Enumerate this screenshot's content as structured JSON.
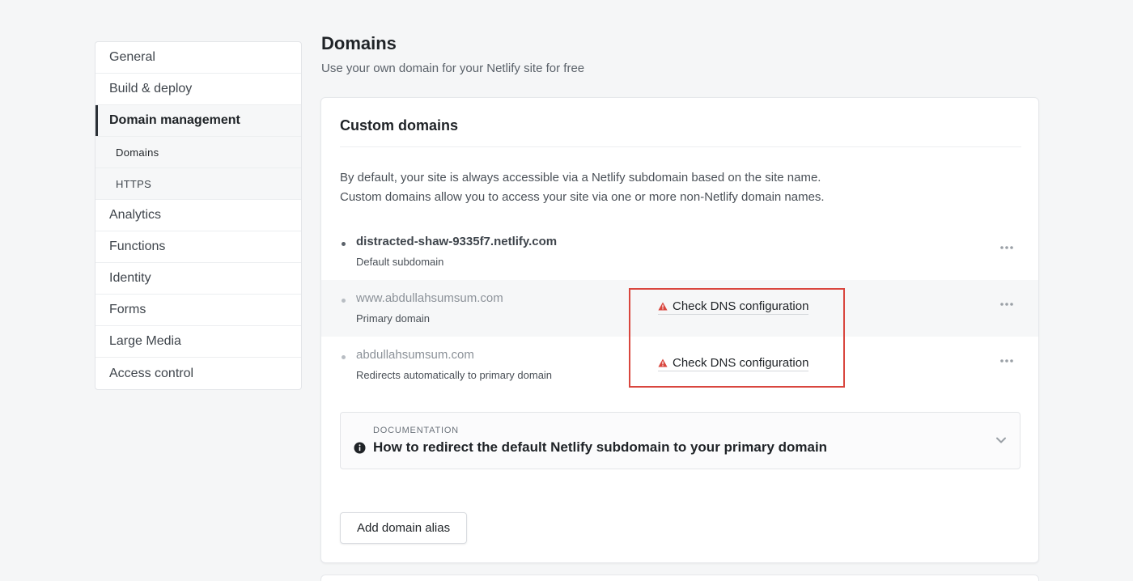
{
  "sidebar": {
    "items": [
      {
        "label": "General"
      },
      {
        "label": "Build & deploy"
      },
      {
        "label": "Domain management"
      },
      {
        "label": "Analytics"
      },
      {
        "label": "Functions"
      },
      {
        "label": "Identity"
      },
      {
        "label": "Forms"
      },
      {
        "label": "Large Media"
      },
      {
        "label": "Access control"
      }
    ],
    "active": "Domain management",
    "subitems": [
      {
        "label": "Domains"
      },
      {
        "label": "HTTPS"
      }
    ]
  },
  "header": {
    "title": "Domains",
    "subtitle": "Use your own domain for your Netlify site for free"
  },
  "card": {
    "title": "Custom domains",
    "intro_line1": "By default, your site is always accessible via a Netlify subdomain based on the site name.",
    "intro_line2": "Custom domains allow you to access your site via one or more non-Netlify domain names.",
    "domains": [
      {
        "name": "distracted-shaw-9335f7.netlify.com",
        "description": "Default subdomain"
      },
      {
        "name": "www.abdullahsumsum.com",
        "description": "Primary domain",
        "warning": "Check DNS configuration"
      },
      {
        "name": "abdullahsumsum.com",
        "description": "Redirects automatically to primary domain",
        "warning": "Check DNS configuration"
      }
    ],
    "documentation": {
      "label": "DOCUMENTATION",
      "title": "How to redirect the default Netlify subdomain to your primary domain"
    },
    "add_alias_label": "Add domain alias"
  },
  "colors": {
    "warning": "#d9463e",
    "highlight_border": "#d9463e",
    "background": "#f5f6f7"
  },
  "icons": {
    "warning": "warning-triangle-icon",
    "more": "more-horizontal-icon",
    "info": "info-circle-icon",
    "chevron": "chevron-down-icon"
  }
}
